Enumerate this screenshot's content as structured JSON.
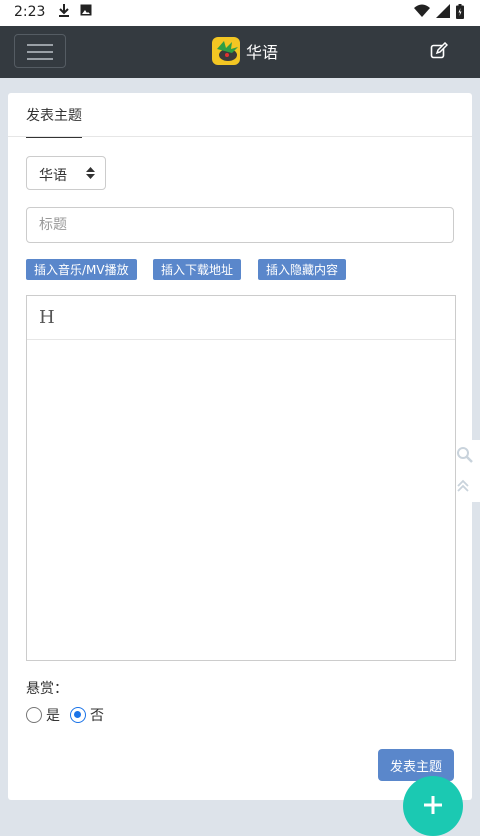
{
  "status_bar": {
    "time": "2:23"
  },
  "navbar": {
    "menu_icon": "hamburger-icon",
    "brand": {
      "logo_icon": "app-logo",
      "title": "华语"
    },
    "edit_icon": "edit-icon"
  },
  "form": {
    "tab": "发表主题",
    "category_select": {
      "value": "华语"
    },
    "title_input": {
      "placeholder": "标题",
      "value": ""
    },
    "insert_buttons": [
      "插入音乐/MV播放",
      "插入下载地址",
      "插入隐藏内容"
    ],
    "editor_toolbar": {
      "heading_button": "H"
    },
    "reward": {
      "label": "悬赏：",
      "options": [
        {
          "label": "是",
          "checked": false
        },
        {
          "label": "否",
          "checked": true
        }
      ]
    },
    "submit_label": "发表主题"
  },
  "floating": {
    "search_icon": "search-icon",
    "top_icon": "double-chevron-up-icon",
    "fab_icon": "plus-icon"
  },
  "colors": {
    "navbar": "#343a40",
    "button": "#5a87cb",
    "fab": "#1bc9b2",
    "radio_checked": "#1a73e8"
  }
}
